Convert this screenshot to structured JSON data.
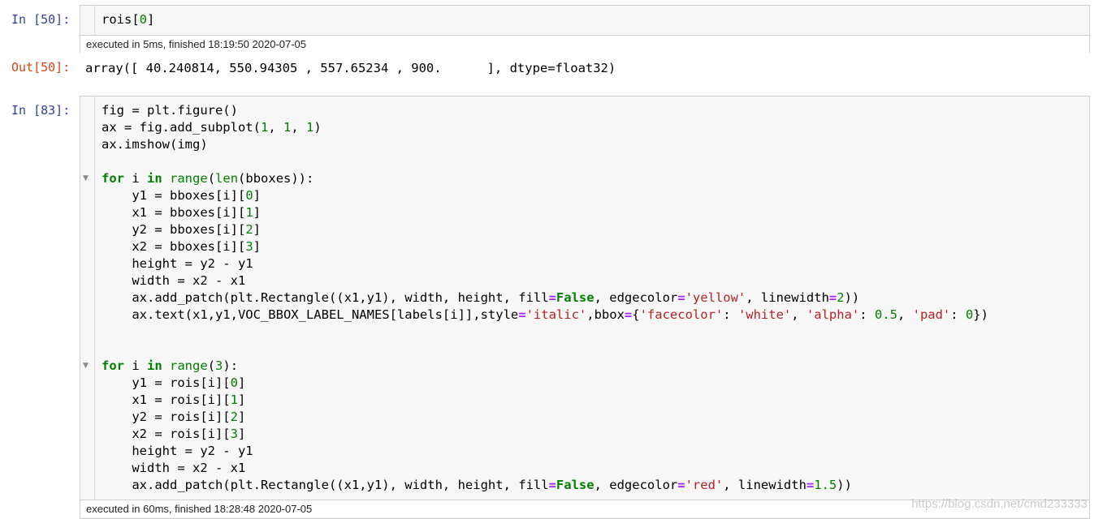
{
  "cells": [
    {
      "prompt": "In [50]:",
      "code": [
        "rois[0]"
      ],
      "exec": "executed in 5ms, finished 18:19:50 2020-07-05"
    },
    {
      "prompt": "Out[50]:",
      "output": "array([ 40.240814, 550.94305 , 557.65234 , 900.      ], dtype=float32)"
    },
    {
      "prompt": "In [83]:",
      "code": [
        "fig = plt.figure()",
        "ax = fig.add_subplot(1, 1, 1)",
        "ax.imshow(img)",
        "",
        "for i in range(len(bboxes)):",
        "    y1 = bboxes[i][0]",
        "    x1 = bboxes[i][1]",
        "    y2 = bboxes[i][2]",
        "    x2 = bboxes[i][3]",
        "    height = y2 - y1",
        "    width = x2 - x1",
        "    ax.add_patch(plt.Rectangle((x1,y1), width, height, fill=False, edgecolor='yellow', linewidth=2))",
        "    ax.text(x1,y1,VOC_BBOX_LABEL_NAMES[labels[i]],style='italic',bbox={'facecolor': 'white', 'alpha': 0.5, 'pad': 0})",
        "",
        "",
        "for i in range(3):",
        "    y1 = rois[i][0]",
        "    x1 = rois[i][1]",
        "    y2 = rois[i][2]",
        "    x2 = rois[i][3]",
        "    height = y2 - y1",
        "    width = x2 - x1",
        "    ax.add_patch(plt.Rectangle((x1,y1), width, height, fill=False, edgecolor='red', linewidth=1.5))"
      ],
      "exec": "executed in 60ms, finished 18:28:48 2020-07-05"
    }
  ],
  "fold_icon": "collapse-triangle-icon",
  "watermark": "https://blog.csdn.net/cmd233333",
  "colors": {
    "in_prompt": "#303F9F",
    "out_prompt": "#D84315",
    "keyword": "#008000",
    "operator": "#AA22FF",
    "string": "#BA2121",
    "number": "#008000",
    "cell_bg": "#f7f7f7",
    "cell_border": "#cfcfcf"
  }
}
